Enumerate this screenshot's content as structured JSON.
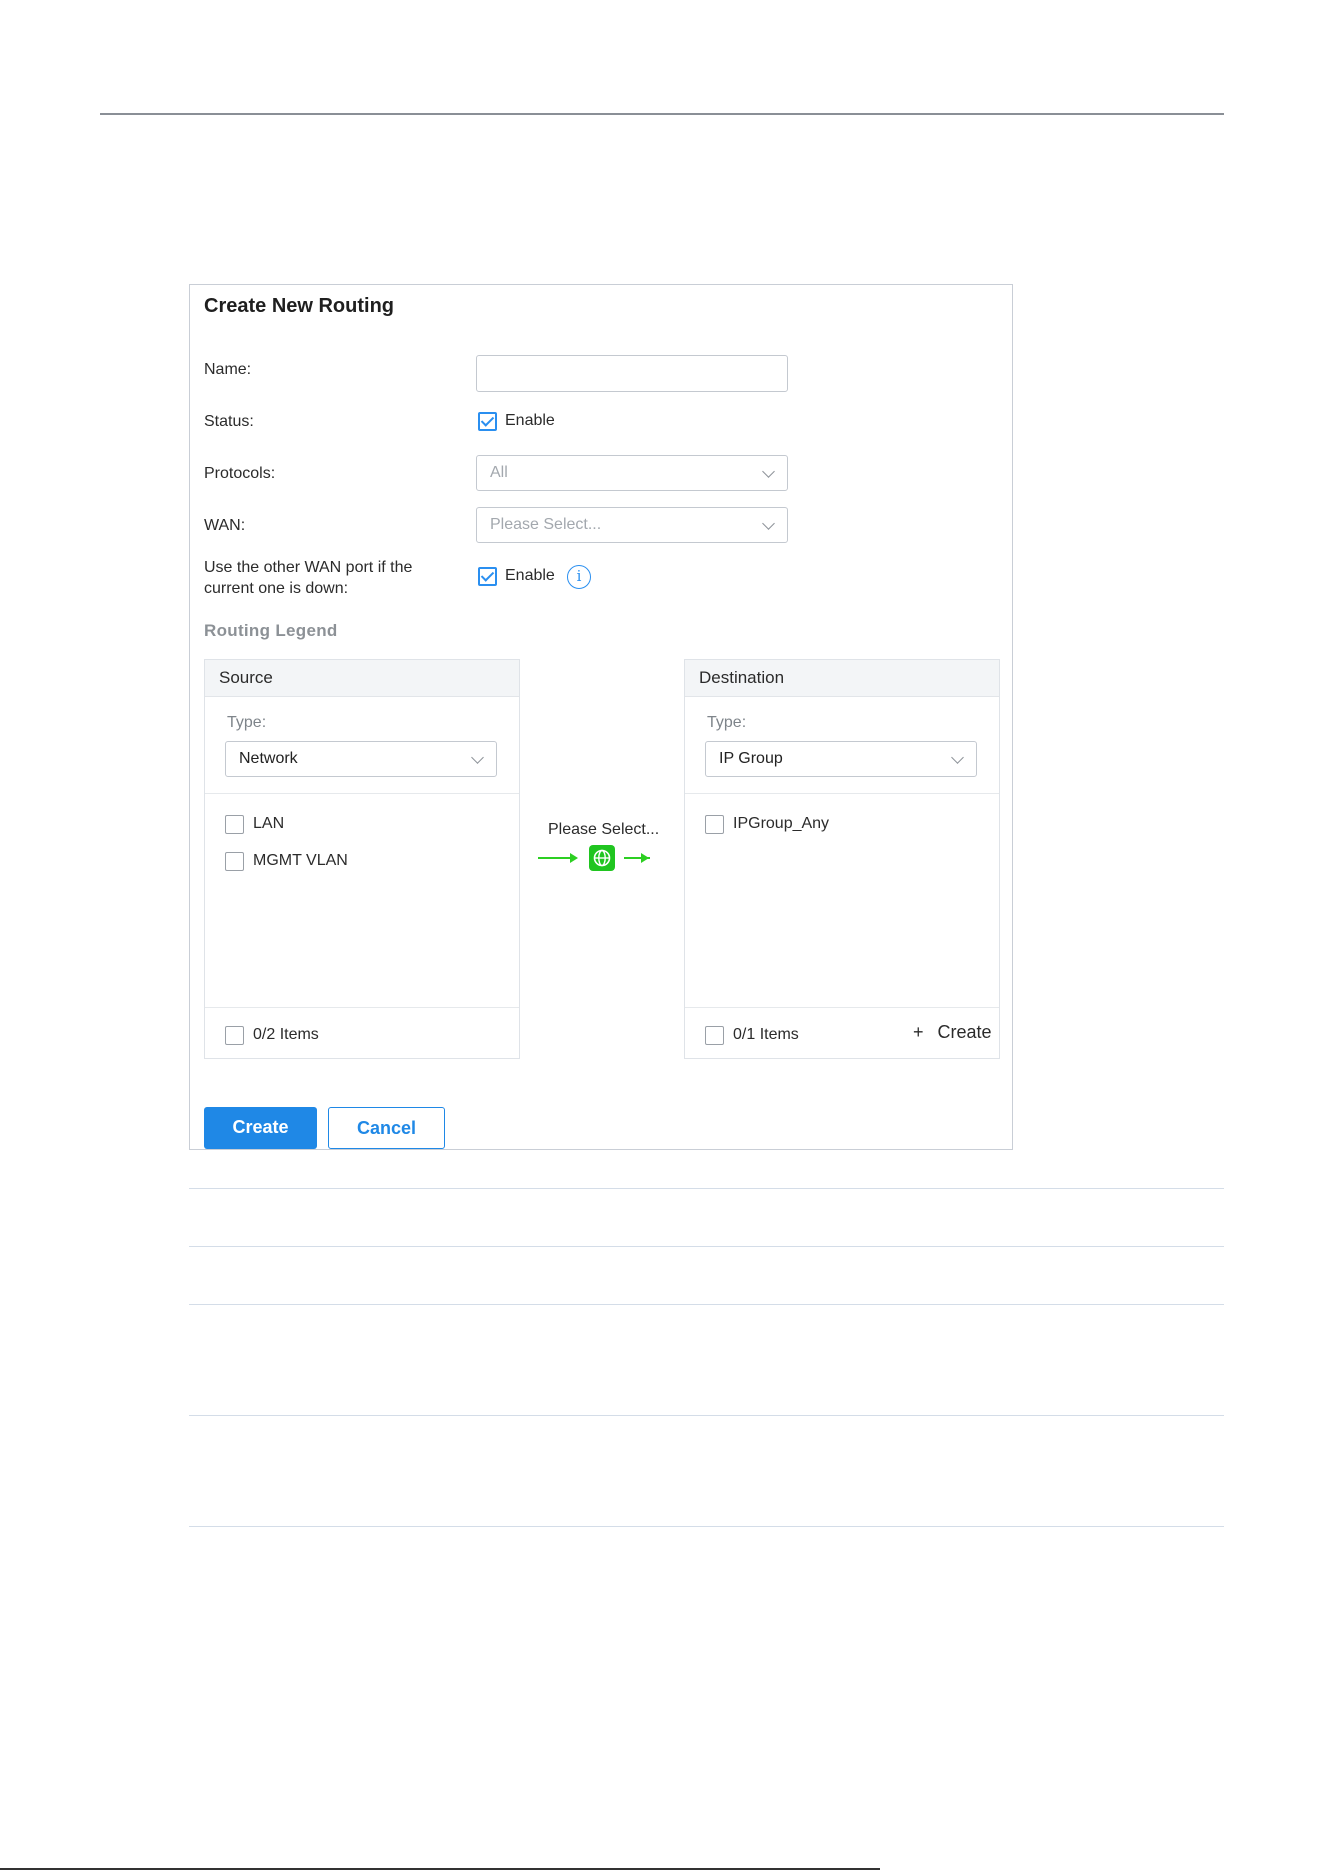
{
  "dialog": {
    "title": "Create New Routing",
    "name": {
      "label": "Name:",
      "value": ""
    },
    "status": {
      "label": "Status:",
      "checkbox_label": "Enable",
      "checked": true
    },
    "protocols": {
      "label": "Protocols:",
      "value": "All"
    },
    "wan": {
      "label": "WAN:",
      "placeholder": "Please Select..."
    },
    "failover": {
      "label_line1": "Use the other WAN port if the",
      "label_line2": "current one is down:",
      "checkbox_label": "Enable",
      "checked": true,
      "info_icon": "info-icon"
    },
    "routing_legend": "Routing Legend",
    "source": {
      "header": "Source",
      "type_label": "Type:",
      "type_value": "Network",
      "items": [
        "LAN",
        "MGMT VLAN"
      ],
      "footer": "0/2 Items"
    },
    "middle": {
      "label": "Please Select...",
      "icon": "globe-icon"
    },
    "destination": {
      "header": "Destination",
      "type_label": "Type:",
      "type_value": "IP Group",
      "items": [
        "IPGroup_Any"
      ],
      "footer": "0/1 Items",
      "create_label": "Create"
    },
    "buttons": {
      "create": "Create",
      "cancel": "Cancel"
    }
  },
  "colors": {
    "accent": "#1f88e6",
    "route_green": "#20c520"
  }
}
